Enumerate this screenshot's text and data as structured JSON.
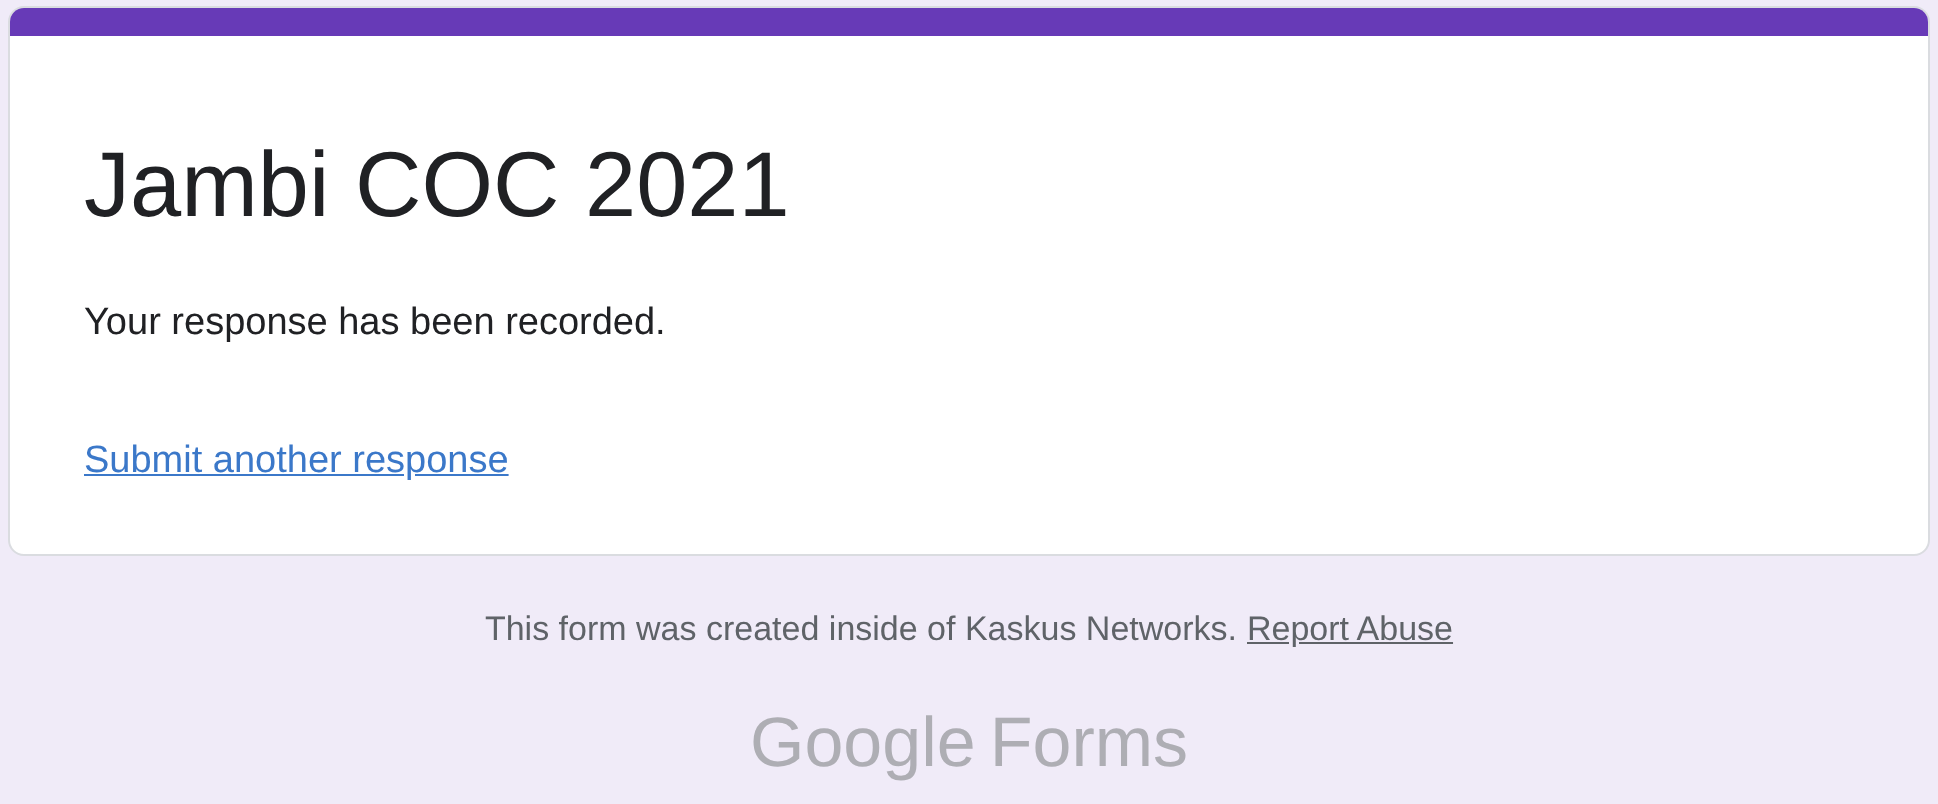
{
  "form": {
    "title": "Jambi COC 2021",
    "message": "Your response has been recorded.",
    "link": "Submit another response"
  },
  "footer": {
    "text": "This form was created inside of Kaskus Networks.",
    "link": "Report Abuse"
  },
  "logo": {
    "brand": "Google",
    "product": "Forms"
  }
}
